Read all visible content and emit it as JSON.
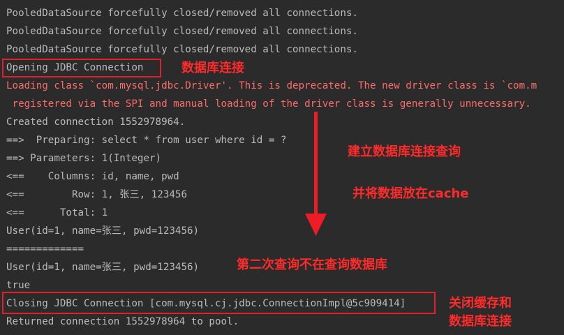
{
  "console": {
    "lines": [
      "PooledDataSource forcefully closed/removed all connections.",
      "PooledDataSource forcefully closed/removed all connections.",
      "PooledDataSource forcefully closed/removed all connections.",
      "Opening JDBC Connection",
      "Loading class `com.mysql.jdbc.Driver'. This is deprecated. The new driver class is `com.m",
      " registered via the SPI and manual loading of the driver class is generally unnecessary.",
      "Created connection 1552978964.",
      "==>  Preparing: select * from user where id = ?",
      "==> Parameters: 1(Integer)",
      "<==    Columns: id, name, pwd",
      "<==        Row: 1, 张三, 123456",
      "<==      Total: 1",
      "User(id=1, name=张三, pwd=123456)",
      "=============",
      "User(id=1, name=张三, pwd=123456)",
      "true",
      "Closing JDBC Connection [com.mysql.cj.jdbc.ConnectionImpl@5c909414]",
      "Returned connection 1552978964 to pool."
    ]
  },
  "annotations": {
    "db_connect": "数据库连接",
    "establish_query": "建立数据库连接查询",
    "cache_data": "并将数据放在cache",
    "second_query": "第二次查询不在查询数据库",
    "close_cache_line1": "关闭缓存和",
    "close_cache_line2": "数据库连接"
  },
  "colors": {
    "background": "#2b2b2b",
    "text": "#bbbbbb",
    "error_text": "#ff6b68",
    "annotation": "#ff2b2b",
    "box": "#e0202a"
  }
}
